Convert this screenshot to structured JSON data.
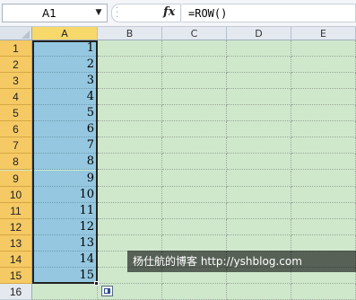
{
  "formula_bar": {
    "name_box": "A1",
    "fx_label": "fx",
    "formula": "=ROW()"
  },
  "columns": [
    "A",
    "B",
    "C",
    "D",
    "E"
  ],
  "rows": [
    "1",
    "2",
    "3",
    "4",
    "5",
    "6",
    "7",
    "8",
    "9",
    "10",
    "11",
    "12",
    "13",
    "14",
    "15",
    "16"
  ],
  "column_a_values": [
    "1",
    "2",
    "3",
    "4",
    "5",
    "6",
    "7",
    "8",
    "9",
    "10",
    "11",
    "12",
    "13",
    "14",
    "15"
  ],
  "watermark": "杨仕航的博客 http://yshblog.com"
}
